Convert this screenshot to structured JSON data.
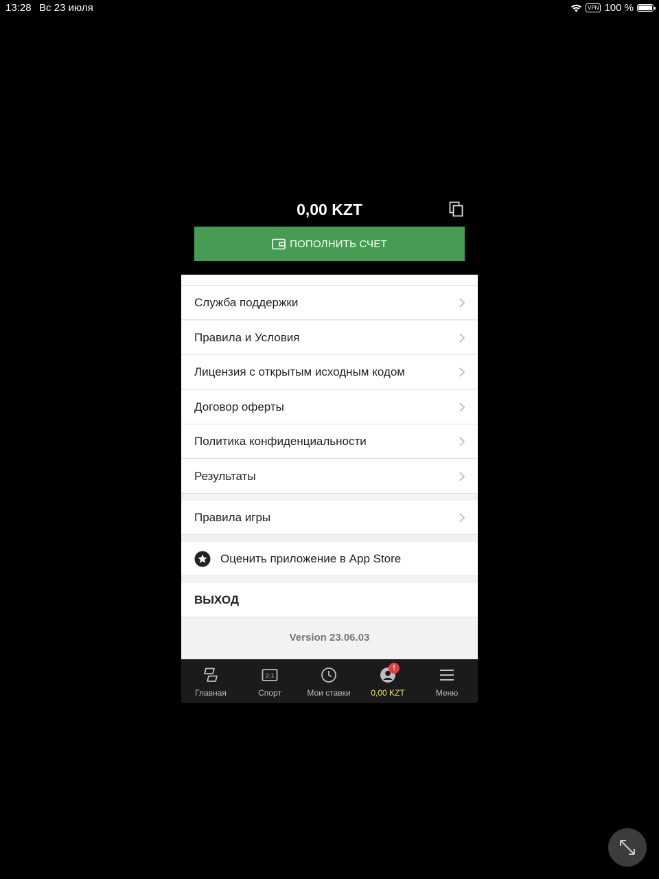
{
  "status_bar": {
    "time": "13:28",
    "date": "Вс 23 июля",
    "vpn": "VPN",
    "battery": "100 %"
  },
  "balance": {
    "amount": "0,00 KZT"
  },
  "deposit": {
    "label": "ПОПОЛНИТЬ СЧЕТ"
  },
  "menu": {
    "items": [
      {
        "label": "Служба поддержки"
      },
      {
        "label": "Правила и Условия"
      },
      {
        "label": "Лицензия с открытым исходным кодом"
      },
      {
        "label": "Договор оферты"
      },
      {
        "label": "Политика конфиденциальности"
      },
      {
        "label": "Результаты"
      }
    ],
    "game_rules": "Правила игры",
    "rate_app": "Оценить приложение в App Store",
    "logout": "ВЫХОД",
    "version": "Version 23.06.03"
  },
  "tabs": [
    {
      "label": "Главная",
      "icon": "home-icon"
    },
    {
      "label": "Спорт",
      "icon": "scoreboard-icon"
    },
    {
      "label": "Мои ставки",
      "icon": "clock-icon"
    },
    {
      "label": "0,00 KZT",
      "icon": "account-icon",
      "badge": "!"
    },
    {
      "label": "Меню",
      "icon": "hamburger-icon"
    }
  ],
  "colors": {
    "accent_green": "#459c52",
    "active_tab": "#e8e35a",
    "badge_red": "#e04040"
  }
}
